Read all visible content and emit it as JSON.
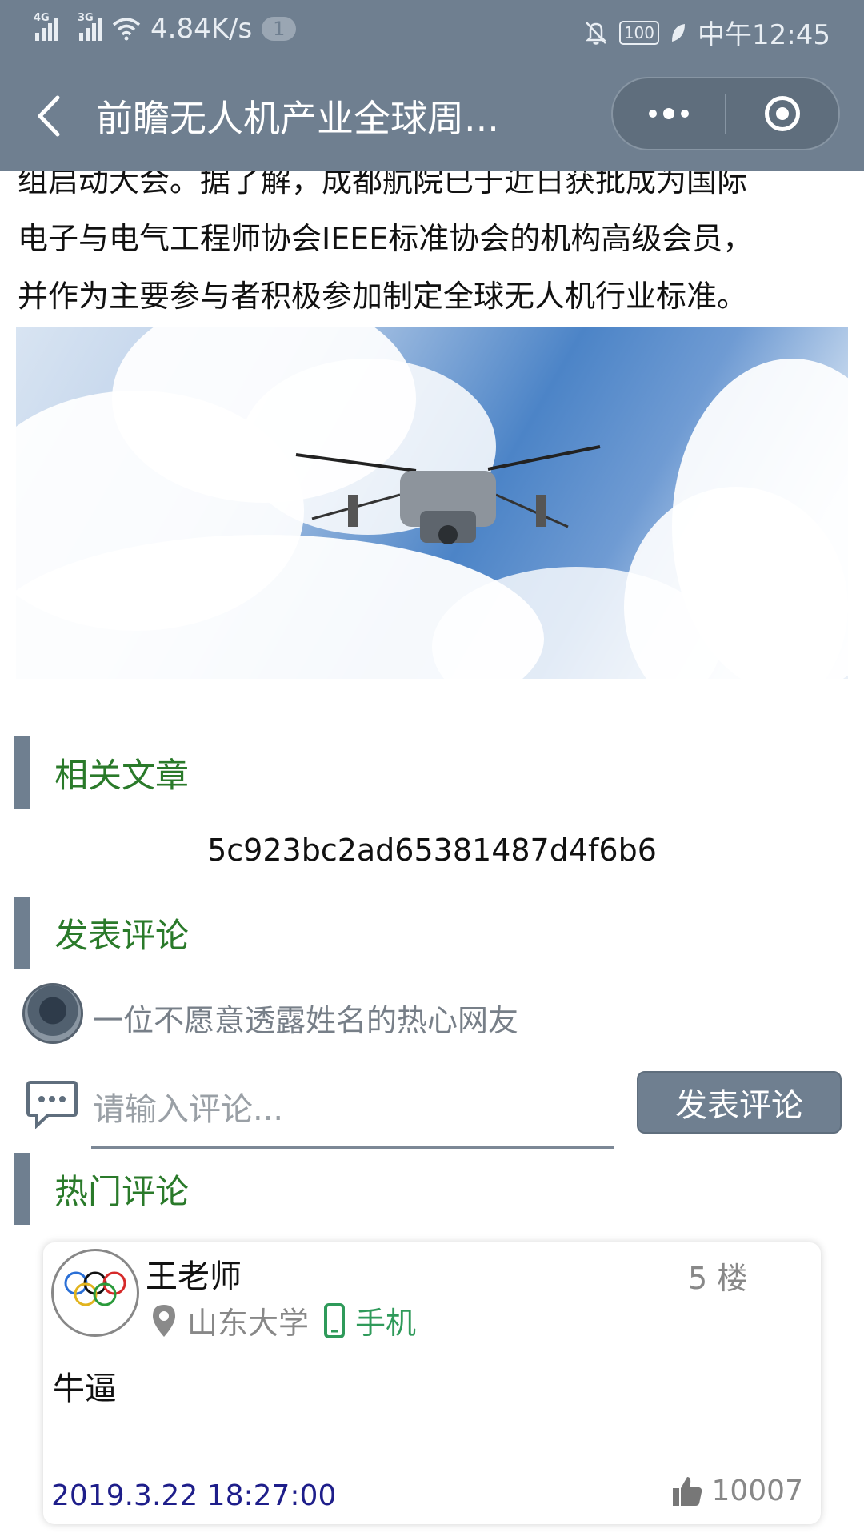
{
  "status_bar": {
    "network_1": "4G",
    "network_2": "3G",
    "speed": "4.84K/s",
    "notification_count": "1",
    "battery": "100",
    "time": "中午12:45"
  },
  "nav": {
    "title": "前瞻无人机产业全球周..."
  },
  "article": {
    "lines": [
      "组启动大会。据了解，成都航院已于近日获批成为国际",
      "电子与电气工程师协会IEEE标准协会的机构高级会员，",
      "并作为主要参与者积极参加制定全球无人机行业标准。"
    ]
  },
  "related": {
    "title": "相关文章",
    "id": "5c923bc2ad65381487d4f6b6"
  },
  "post_comment": {
    "title": "发表评论",
    "user_name": "一位不愿意透露姓名的热心网友",
    "placeholder": "请输入评论...",
    "button_label": "发表评论"
  },
  "hot_comments": {
    "title": "热门评论",
    "items": [
      {
        "name": "王老师",
        "floor": "5 楼",
        "school": "山东大学",
        "device": "手机",
        "body": "牛逼",
        "date": "2019.3.22 18:27:00",
        "likes": "10007"
      }
    ]
  },
  "colors": {
    "header": "#6f7f90",
    "section_title": "#2a7a2a",
    "device": "#2f9a5a",
    "date": "#1e1e8a"
  }
}
